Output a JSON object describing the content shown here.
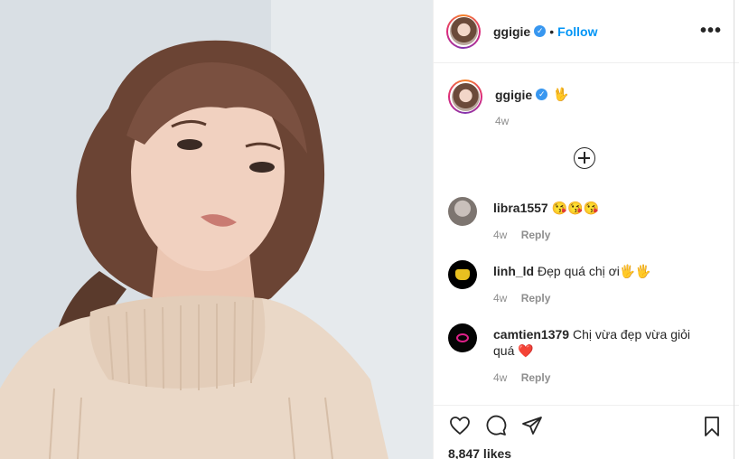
{
  "post": {
    "username": "ggigie",
    "follow_label": "Follow",
    "separator": "•",
    "more_icon": "more-horizontal-icon",
    "caption_emoji": "🖖",
    "caption_time": "4w",
    "likes": "8,847 likes"
  },
  "comments": [
    {
      "username": "libra1557",
      "text": "😘😘😘",
      "time": "4w",
      "reply_label": "Reply"
    },
    {
      "username": "linh_ld",
      "text": "Đẹp quá chị ơi🖐🖐",
      "time": "4w",
      "reply_label": "Reply"
    },
    {
      "username": "camtien1379",
      "text": "Chị vừa đẹp vừa giỏi quá ❤️",
      "time": "4w",
      "reply_label": "Reply"
    }
  ],
  "icons": {
    "like": "heart-icon",
    "comment": "comment-icon",
    "share": "paper-plane-icon",
    "save": "bookmark-icon",
    "load_more": "plus-circle-icon",
    "verified": "verified-badge-icon"
  },
  "colors": {
    "accent": "#0095f6",
    "text": "#262626",
    "muted": "#8e8e8e",
    "border": "#efefef"
  }
}
